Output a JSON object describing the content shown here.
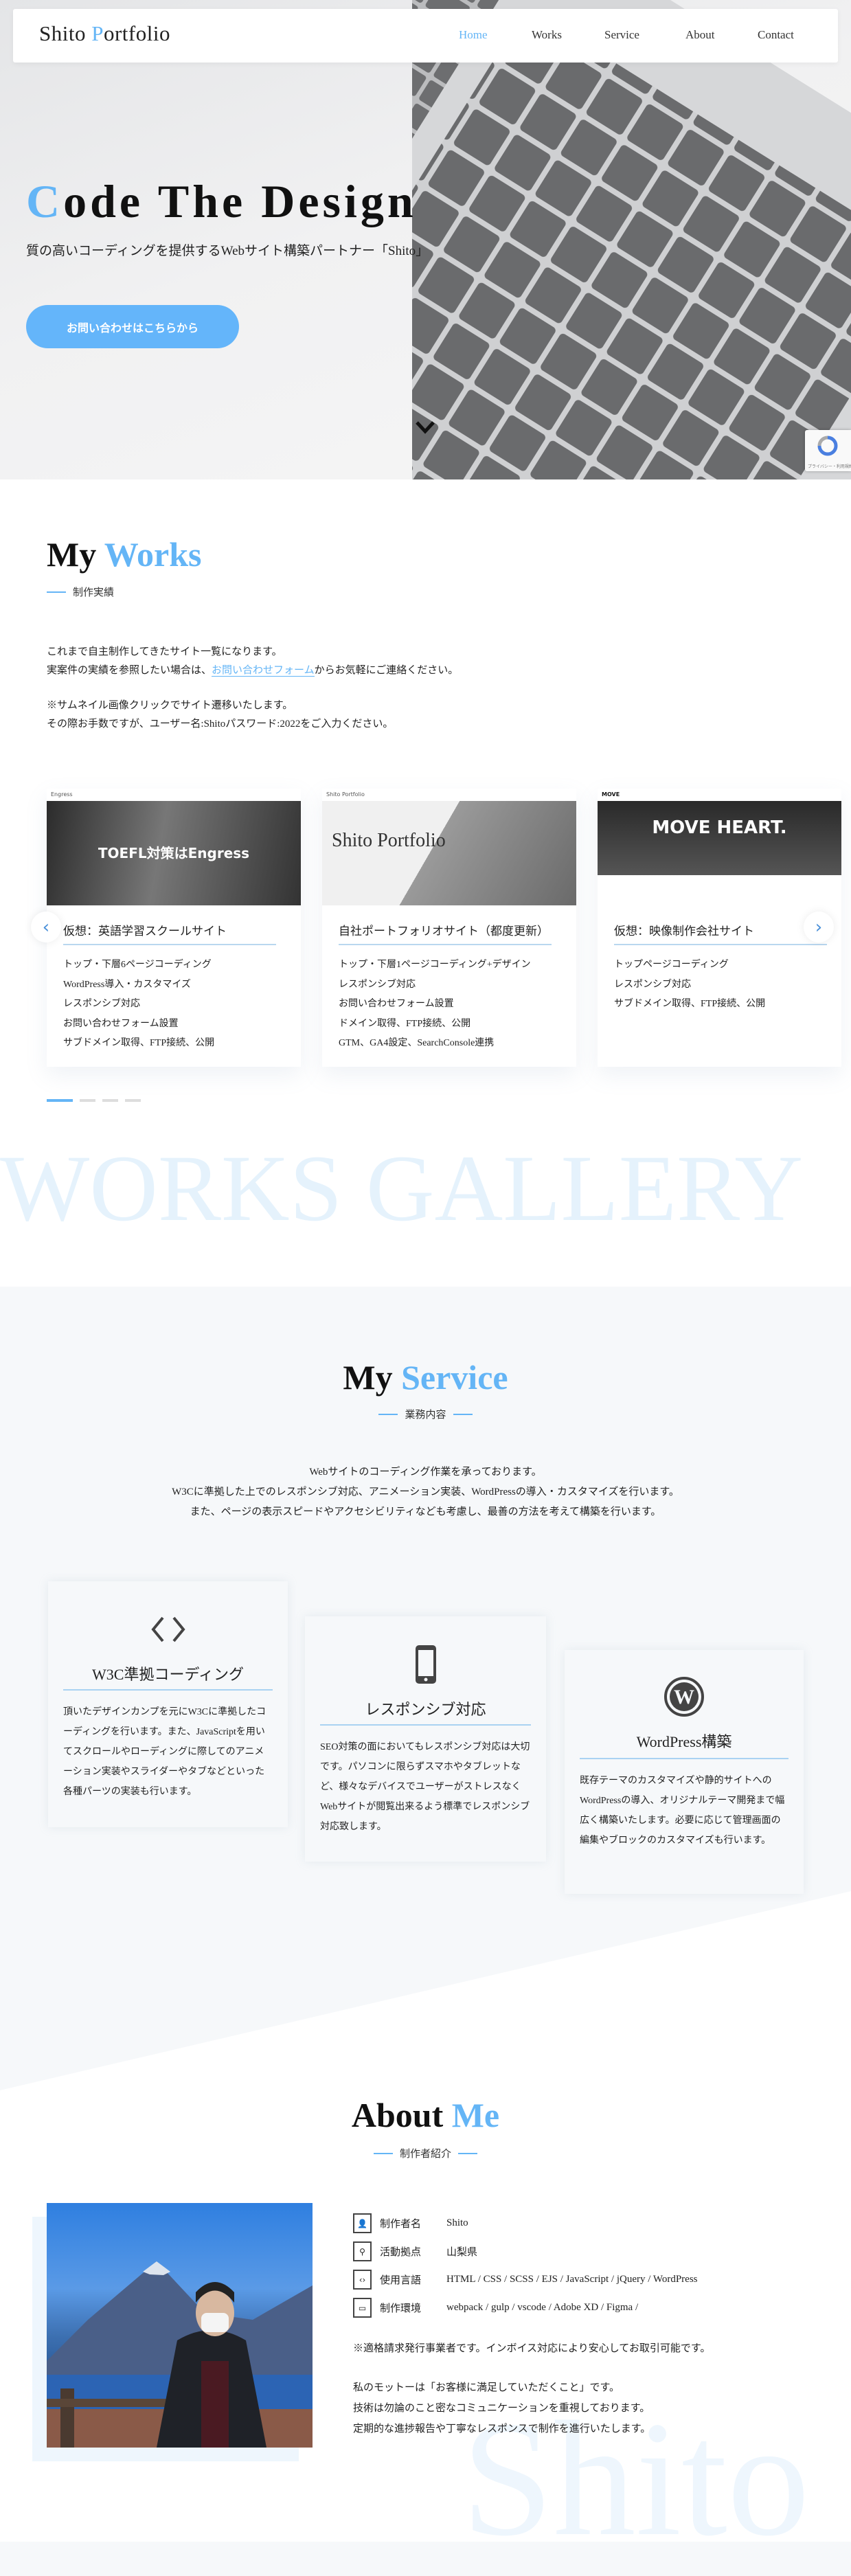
{
  "header": {
    "logo_prefix": "Shito ",
    "logo_accent": "P",
    "logo_suffix": "ortfolio",
    "nav": [
      {
        "label": "Home",
        "active": true
      },
      {
        "label": "Works",
        "active": false
      },
      {
        "label": "Service",
        "active": false
      },
      {
        "label": "About",
        "active": false
      },
      {
        "label": "Contact",
        "active": false
      }
    ]
  },
  "hero": {
    "title_accent": "C",
    "title_rest": "ode The Design",
    "subtitle": "質の高いコーディングを提供するWebサイト構築パートナー「Shito」",
    "cta_label": "お問い合わせはこちらから",
    "scroll_icon": "chevron-down-icon",
    "recaptcha_text": "プライバシー・利用規約"
  },
  "works": {
    "title_plain": "My ",
    "title_accent": "Works",
    "subtitle": "制作実績",
    "intro_line1": "これまで自主制作してきたサイト一覧になります。",
    "intro_line2_before": "実案件の実績を参照したい場合は、",
    "intro_line2_link": "お問い合わせフォーム",
    "intro_line2_after": "からお気軽にご連絡ください。",
    "note_line1": "※サムネイル画像クリックでサイト遷移いたします。",
    "note_line2": "その際お手数ですが、ユーザー名:Shitoパスワード:2022をご入力ください。",
    "cards": [
      {
        "thumb_brand": "Engress",
        "thumb_text": "TOEFL対策はEngress",
        "title": "仮想：英語学習スクールサイト",
        "items": [
          "トップ・下層6ページコーディング",
          "WordPress導入・カスタマイズ",
          "レスポンシブ対応",
          "お問い合わせフォーム設置",
          "サブドメイン取得、FTP接続、公開"
        ]
      },
      {
        "thumb_brand": "Shito Portfolio",
        "thumb_text": "Shito Portfolio",
        "title": "自社ポートフォリオサイト（都度更新）",
        "items": [
          "トップ・下層1ページコーディング+デザイン",
          "レスポンシブ対応",
          "お問い合わせフォーム設置",
          "ドメイン取得、FTP接続、公開",
          "GTM、GA4設定、SearchConsole連携"
        ]
      },
      {
        "thumb_brand": "MOVE",
        "thumb_text": "MOVE HEART.",
        "title": "仮想：映像制作会社サイト",
        "items": [
          "トップページコーディング",
          "レスポンシブ対応",
          "サブドメイン取得、FTP接続、公開"
        ]
      }
    ],
    "prev_icon": "chevron-left-icon",
    "next_icon": "chevron-right-icon",
    "slider_active_index": 0,
    "slider_count": 4,
    "watermark": "WORKS GALLERY"
  },
  "service": {
    "title_plain": "My ",
    "title_accent": "Service",
    "subtitle": "業務内容",
    "intro": [
      "Webサイトのコーディング作業を承っております。",
      "W3Cに準拠した上でのレスポンシブ対応、アニメーション実装、WordPressの導入・カスタマイズを行います。",
      "また、ページの表示スピードやアクセシビリティなども考慮し、最善の方法を考えて構築を行います。"
    ],
    "cards": [
      {
        "icon": "code-icon",
        "title": "W3C準拠コーディング",
        "text": "頂いたデザインカンプを元にW3Cに準拠したコーディングを行います。また、JavaScriptを用いてスクロールやローディングに際してのアニメーション実装やスライダーやタブなどといった各種パーツの実装も行います。"
      },
      {
        "icon": "smartphone-icon",
        "title": "レスポンシブ対応",
        "text": "SEO対策の面においてもレスポンシブ対応は大切です。パソコンに限らずスマホやタブレットなど、様々なデバイスでユーザーがストレスなくWebサイトが閲覧出来るよう標準でレスポンシブ対応致します。"
      },
      {
        "icon": "wordpress-icon",
        "title": "WordPress構築",
        "text": "既存テーマのカスタマイズや静的サイトへのWordPressの導入、オリジナルテーマ開発まで幅広く構築いたします。必要に応じて管理画面の編集やブロックのカスタマイズも行います。"
      }
    ]
  },
  "about": {
    "title_plain": "About ",
    "title_accent": "Me",
    "subtitle": "制作者紹介",
    "info": [
      {
        "icon": "user-icon",
        "label": "制作者名",
        "value": "Shito"
      },
      {
        "icon": "map-pin-icon",
        "label": "活動拠点",
        "value": "山梨県"
      },
      {
        "icon": "code-icon",
        "label": "使用言語",
        "value": "HTML / CSS / SCSS / EJS / JavaScript / jQuery / WordPress"
      },
      {
        "icon": "laptop-icon",
        "label": "制作環境",
        "value": "webpack / gulp / vscode / Adobe XD / Figma /"
      }
    ],
    "note": "※適格請求発行事業者です。インボイス対応により安心してお取引可能です。",
    "motto": [
      "私のモットーは「お客様に満足していただくこと」です。",
      "技術は勿論のこと密なコミュニケーションを重視しております。",
      "定期的な進捗報告や丁寧なレスポンスで制作を進行いたします。"
    ],
    "watermark": "Shito"
  },
  "colors": {
    "accent": "#64b5f6",
    "button": "#64b5fa",
    "service_bg": "#f6f8fa",
    "watermark": "#e5f2fc"
  }
}
